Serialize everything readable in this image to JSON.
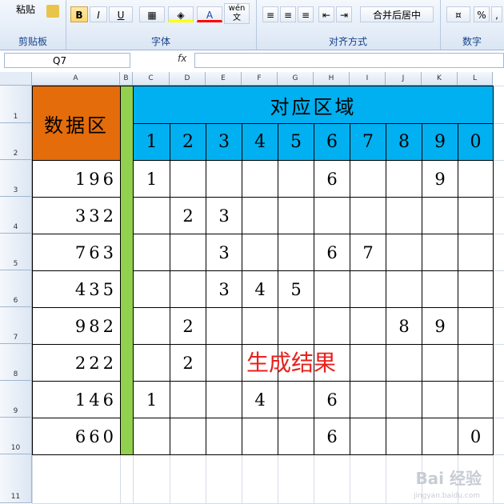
{
  "ribbon": {
    "paste_label": "粘贴",
    "clipboard_label": "剪贴板",
    "font_label": "字体",
    "align_label": "对齐方式",
    "number_label": "数字",
    "bold": "B",
    "italic": "I",
    "underline": "U",
    "font_color": "A",
    "wen": "wén",
    "wen_char": "文",
    "merge_center": "合并后居中",
    "percent": "%",
    "comma": ","
  },
  "formula_bar": {
    "name_box": "Q7",
    "fx": "fx",
    "value": ""
  },
  "columns": [
    "A",
    "B",
    "C",
    "D",
    "E",
    "F",
    "G",
    "H",
    "I",
    "J",
    "K",
    "L"
  ],
  "rows": [
    "1",
    "2",
    "3",
    "4",
    "5",
    "6",
    "7",
    "8",
    "9",
    "10",
    "11"
  ],
  "sheet": {
    "data_header": "数据区",
    "region_header": "对应区域",
    "digits": [
      "1",
      "2",
      "3",
      "4",
      "5",
      "6",
      "7",
      "8",
      "9",
      "0"
    ],
    "data_values": [
      "196",
      "332",
      "763",
      "435",
      "982",
      "222",
      "146",
      "660"
    ],
    "results": [
      [
        "1",
        "",
        "",
        "",
        "",
        "6",
        "",
        "",
        "9",
        ""
      ],
      [
        "",
        "2",
        "3",
        "",
        "",
        "",
        "",
        "",
        "",
        ""
      ],
      [
        "",
        "",
        "3",
        "",
        "",
        "6",
        "7",
        "",
        "",
        ""
      ],
      [
        "",
        "",
        "3",
        "4",
        "5",
        "",
        "",
        "",
        "",
        ""
      ],
      [
        "",
        "2",
        "",
        "",
        "",
        "",
        "",
        "8",
        "9",
        ""
      ],
      [
        "",
        "2",
        "",
        "",
        "",
        "",
        "",
        "",
        "",
        ""
      ],
      [
        "1",
        "",
        "",
        "4",
        "",
        "6",
        "",
        "",
        "",
        ""
      ],
      [
        "",
        "",
        "",
        "",
        "",
        "6",
        "",
        "",
        "",
        "0"
      ]
    ]
  },
  "overlay_text": "生成结果",
  "watermark": "Bai 经验",
  "watermark_url": "jingyan.baidu.com"
}
